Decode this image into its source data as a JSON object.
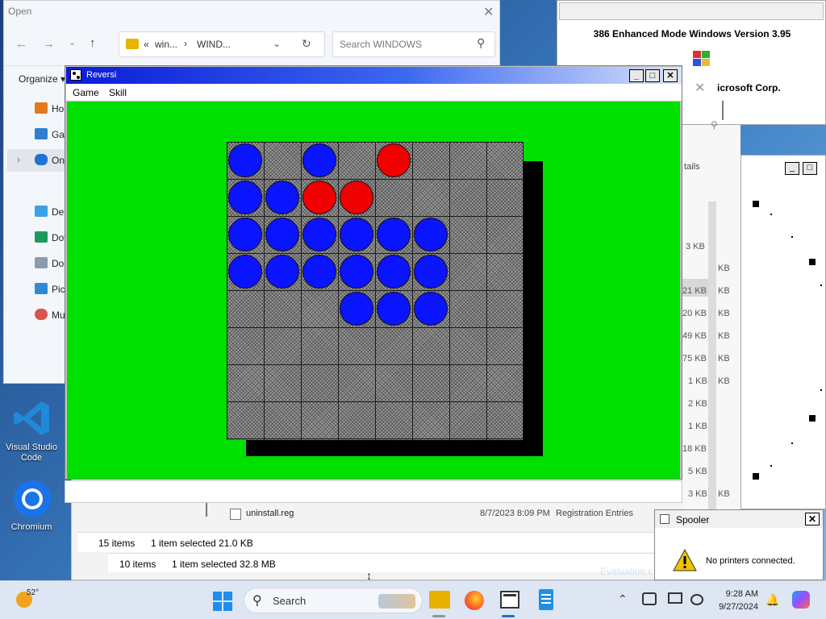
{
  "explorer_open": {
    "title": "Open",
    "address_crumbs": [
      "«",
      "win...",
      "›",
      "WIND..."
    ],
    "search_placeholder": "Search WINDOWS",
    "organize_label": "Organize",
    "sidebar": [
      {
        "label": "Hor",
        "icon": "home-icon",
        "color": "#e07a1f"
      },
      {
        "label": "Gall",
        "icon": "gallery-icon",
        "color": "#2d7fd1"
      },
      {
        "label": "One",
        "icon": "onedrive-icon",
        "color": "#1f72d1"
      },
      {
        "label": "Des",
        "icon": "desktop-icon",
        "color": "#3aa0e8"
      },
      {
        "label": "Dov",
        "icon": "downloads-icon",
        "color": "#1c9a5a"
      },
      {
        "label": "Doc",
        "icon": "documents-icon",
        "color": "#8a9bb0"
      },
      {
        "label": "Pict",
        "icon": "pictures-icon",
        "color": "#2f8ad6"
      },
      {
        "label": "Mu",
        "icon": "music-icon",
        "color": "#d9534f"
      }
    ]
  },
  "about_386": {
    "title": "386 Enhanced Mode Windows Version 3.95",
    "copyright": "icrosoft Corp."
  },
  "back_explorer": {
    "details_label": "tails",
    "sizes": [
      "3 KB",
      "21 KB",
      "20 KB",
      "49 KB",
      "75 KB",
      "1 KB",
      "2 KB",
      "1 KB",
      "18 KB",
      "5 KB",
      "3 KB"
    ],
    "sizes_right": [
      "KB",
      "KB",
      "KB",
      "KB",
      "KB",
      "KB",
      "KB",
      "KB"
    ],
    "row_name": "uninstall.reg",
    "row_date": "8/7/2023 8:09 PM",
    "row_type": "Registration Entries"
  },
  "reversi": {
    "title": "Reversi",
    "menu": [
      "Game",
      "Skill"
    ],
    "board_rows": [
      [
        "B",
        "",
        "B",
        "",
        "R",
        "",
        "",
        ""
      ],
      [
        "B",
        "B",
        "R",
        "R",
        "",
        "",
        "",
        ""
      ],
      [
        "B",
        "B",
        "B",
        "B",
        "B",
        "B",
        "",
        ""
      ],
      [
        "B",
        "B",
        "B",
        "B",
        "B",
        "B",
        "",
        ""
      ],
      [
        "",
        "",
        "",
        "B",
        "B",
        "B",
        "",
        ""
      ],
      [
        "",
        "",
        "",
        "",
        "",
        "",
        "",
        ""
      ],
      [
        "",
        "",
        "",
        "",
        "",
        "",
        "",
        ""
      ],
      [
        "",
        "",
        "",
        "",
        "",
        "",
        "",
        ""
      ]
    ],
    "colors": {
      "board_bg": "#00e000",
      "blue": "#0a14ff",
      "red": "#f00000"
    }
  },
  "status_bars": [
    {
      "items": "15 items",
      "selected": "1 item selected  21.0 KB"
    },
    {
      "items": "10 items",
      "selected": "1 item selected  32.8 MB"
    }
  ],
  "spooler": {
    "title": "Spooler",
    "message": "No printers connected."
  },
  "desktop_icons": [
    {
      "label": "Visual Studio Code",
      "icon": "vscode-icon"
    },
    {
      "label": "Chromium",
      "icon": "chromium-icon"
    }
  ],
  "evaluation_text": "Evaluation c",
  "taskbar": {
    "weather_temp": "52°",
    "search_label": "Search",
    "time": "9:28 AM",
    "date": "9/27/2024"
  }
}
